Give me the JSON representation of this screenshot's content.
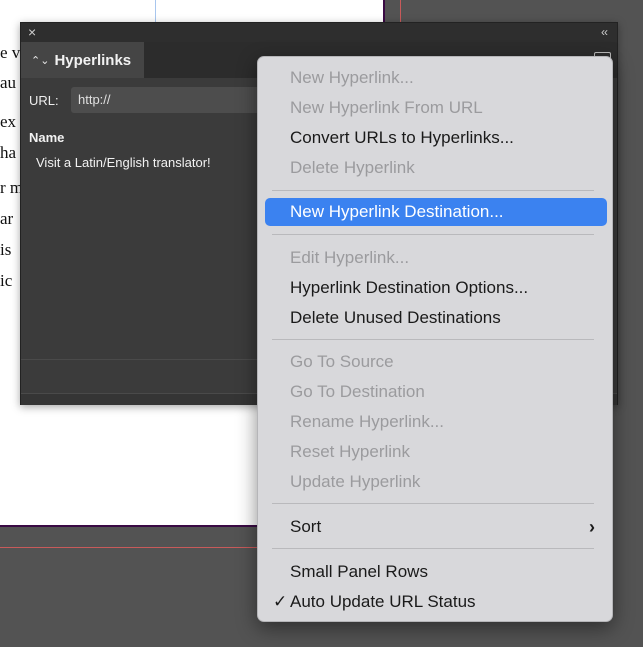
{
  "document": {
    "text_fragments": [
      "e v",
      "au",
      "ex",
      "ha",
      "r m",
      "ar",
      "is",
      "ic"
    ]
  },
  "panel": {
    "title": "Hyperlinks",
    "tab_arrows": "⌃⌄",
    "close_icon": "×",
    "collapse_icon": "‹‹",
    "url_label": "URL:",
    "url_value": "http://",
    "column_header": "Name",
    "rows": [
      "Visit a Latin/English translator!"
    ]
  },
  "menu": {
    "items": [
      {
        "label": "New Hyperlink...",
        "state": "disabled"
      },
      {
        "label": "New Hyperlink From URL",
        "state": "disabled"
      },
      {
        "label": "Convert URLs to Hyperlinks...",
        "state": "enabled"
      },
      {
        "label": "Delete Hyperlink",
        "state": "disabled"
      },
      {
        "label": "New Hyperlink Destination...",
        "state": "highlighted"
      },
      {
        "label": "Edit Hyperlink...",
        "state": "disabled"
      },
      {
        "label": "Hyperlink Destination Options...",
        "state": "enabled"
      },
      {
        "label": "Delete Unused Destinations",
        "state": "enabled"
      },
      {
        "label": "Go To Source",
        "state": "disabled"
      },
      {
        "label": "Go To Destination",
        "state": "disabled"
      },
      {
        "label": "Rename Hyperlink...",
        "state": "disabled"
      },
      {
        "label": "Reset Hyperlink",
        "state": "disabled"
      },
      {
        "label": "Update Hyperlink",
        "state": "disabled"
      },
      {
        "label": "Sort",
        "state": "enabled",
        "submenu_icon": "chevron-right-icon"
      },
      {
        "label": "Small Panel Rows",
        "state": "enabled"
      },
      {
        "label": "Auto Update URL Status",
        "state": "enabled",
        "checked": true
      }
    ],
    "check_mark": "✓",
    "submenu_glyph": "›"
  },
  "colors": {
    "highlight": "#3b82f0",
    "menu_background": "#d8d8db",
    "panel_background": "#3b3b3b"
  }
}
